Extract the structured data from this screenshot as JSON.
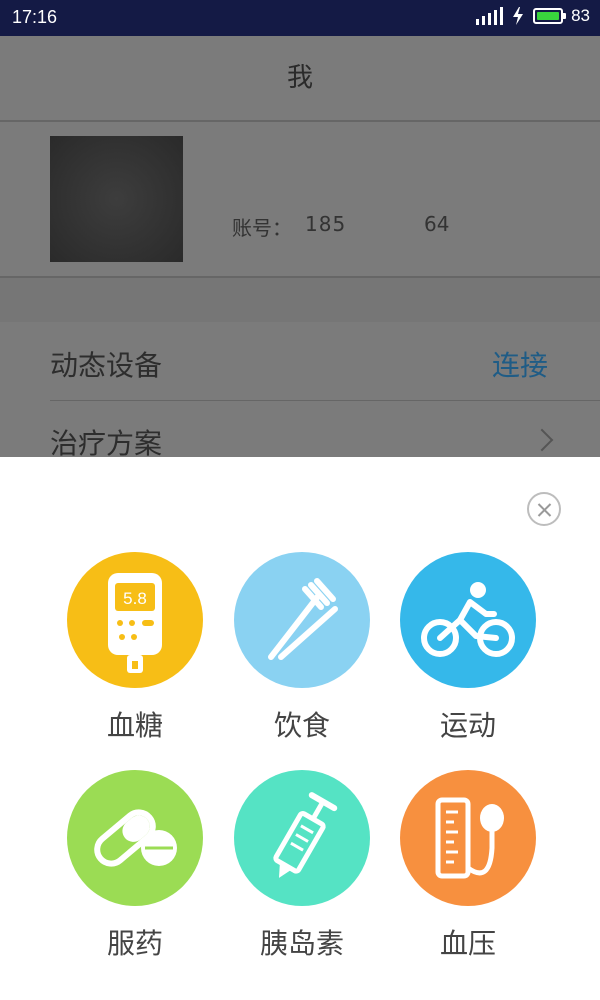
{
  "status_bar": {
    "time": "17:16",
    "battery": "83"
  },
  "page": {
    "title": "我",
    "account_label": "账号：",
    "account_value": "185",
    "account_tail": "64",
    "rows": [
      {
        "label": "动态设备",
        "action": "连接"
      },
      {
        "label": "治疗方案"
      }
    ]
  },
  "sheet": {
    "items": [
      {
        "label": "血糖",
        "icon": "glucose-meter-icon",
        "color": "#f7be16",
        "display": "5.8"
      },
      {
        "label": "饮食",
        "icon": "fork-knife-icon",
        "color": "#8ad2f2"
      },
      {
        "label": "运动",
        "icon": "bicycle-icon",
        "color": "#35b8ea"
      },
      {
        "label": "服药",
        "icon": "pills-icon",
        "color": "#9bdc54"
      },
      {
        "label": "胰岛素",
        "icon": "syringe-icon",
        "color": "#55e3c4"
      },
      {
        "label": "血压",
        "icon": "blood-pressure-gauge-icon",
        "color": "#f7903f"
      }
    ]
  }
}
